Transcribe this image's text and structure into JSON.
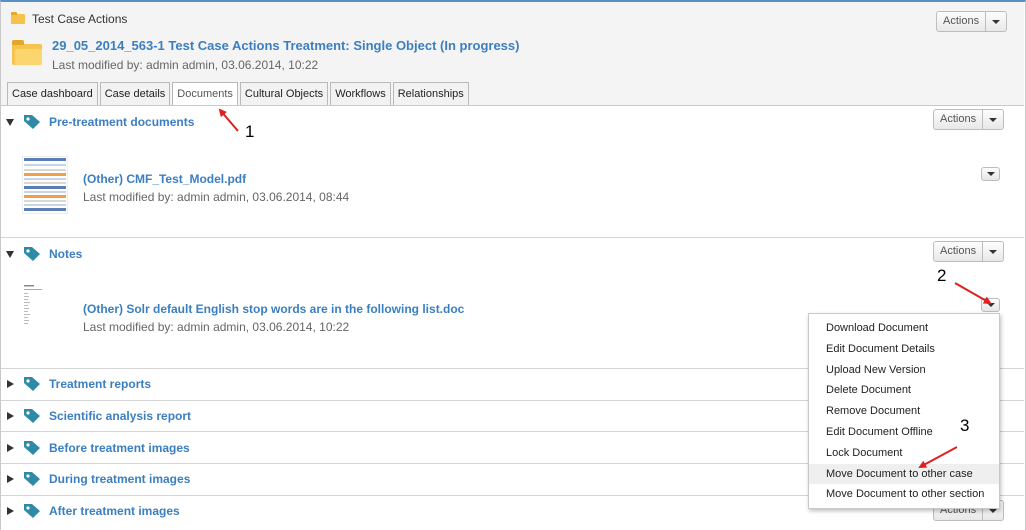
{
  "header": {
    "breadcrumb": "Test Case Actions",
    "case_title": "29_05_2014_563-1 Test Case Actions Treatment: Single Object (In progress)",
    "case_meta": "Last modified by: admin admin, 03.06.2014, 10:22",
    "actions_label": "Actions"
  },
  "tabs": [
    {
      "label": "Case dashboard"
    },
    {
      "label": "Case details"
    },
    {
      "label": "Documents"
    },
    {
      "label": "Cultural Objects"
    },
    {
      "label": "Workflows"
    },
    {
      "label": "Relationships"
    }
  ],
  "sections": {
    "pre": {
      "title": "Pre-treatment documents",
      "actions_label": "Actions",
      "doc": {
        "title": "(Other) CMF_Test_Model.pdf",
        "meta": "Last modified by: admin admin, 03.06.2014, 08:44"
      }
    },
    "notes": {
      "title": "Notes",
      "actions_label": "Actions",
      "doc": {
        "title": "(Other) Solr default English stop words are in the following list.doc",
        "meta": "Last modified by: admin admin, 03.06.2014, 10:22"
      }
    },
    "treatment_reports": {
      "title": "Treatment reports"
    },
    "scientific": {
      "title": "Scientific analysis report"
    },
    "before": {
      "title": "Before treatment images"
    },
    "during": {
      "title": "During treatment images"
    },
    "after": {
      "title": "After treatment images",
      "actions_label": "Actions"
    }
  },
  "document_menu": {
    "items": [
      "Download Document",
      "Edit Document Details",
      "Upload New Version",
      "Delete Document",
      "Remove Document",
      "Edit Document Offline",
      "Lock Document",
      "Move Document to other case",
      "Move Document to other section"
    ]
  },
  "annotations": {
    "one": "1",
    "two": "2",
    "three": "3"
  },
  "colors": {
    "link_blue": "#3b7fc1",
    "tag_teal": "#2f8aa8",
    "arrow_red": "#e02020"
  },
  "icons": [
    "folder-icon",
    "tag-icon",
    "chevron-down-icon",
    "expand-triangle-icon",
    "collapse-triangle-icon"
  ]
}
